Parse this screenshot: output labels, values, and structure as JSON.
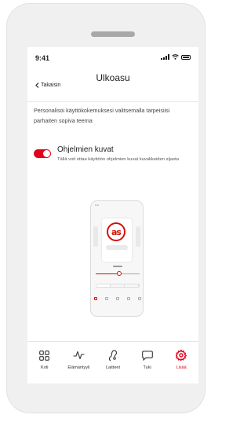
{
  "status_bar": {
    "time": "9:41"
  },
  "header": {
    "title": "Ulkoasu",
    "back_label": "Takaisin"
  },
  "intro_text": "Personalisoi käyttökokemuksesi valitsemalla tarpeisiisi parhaiten sopiva teema",
  "setting": {
    "title": "Ohjelmien kuvat",
    "description": "Tällä voit ottaa käyttöön ohjelmien kuvat kuvakkeiden sijasta",
    "enabled": true
  },
  "preview": {
    "logo_text": "as",
    "time": "9:41"
  },
  "tabs": [
    {
      "label": "Koti",
      "icon": "grid-icon",
      "active": false
    },
    {
      "label": "Elämäntyyli",
      "icon": "activity-icon",
      "active": false
    },
    {
      "label": "Laitteet",
      "icon": "hearing-aid-icon",
      "active": false
    },
    {
      "label": "Tuki",
      "icon": "chat-icon",
      "active": false
    },
    {
      "label": "Lisää",
      "icon": "gear-icon",
      "active": true
    }
  ],
  "colors": {
    "accent": "#e2001a",
    "logo_red": "#d51007"
  }
}
